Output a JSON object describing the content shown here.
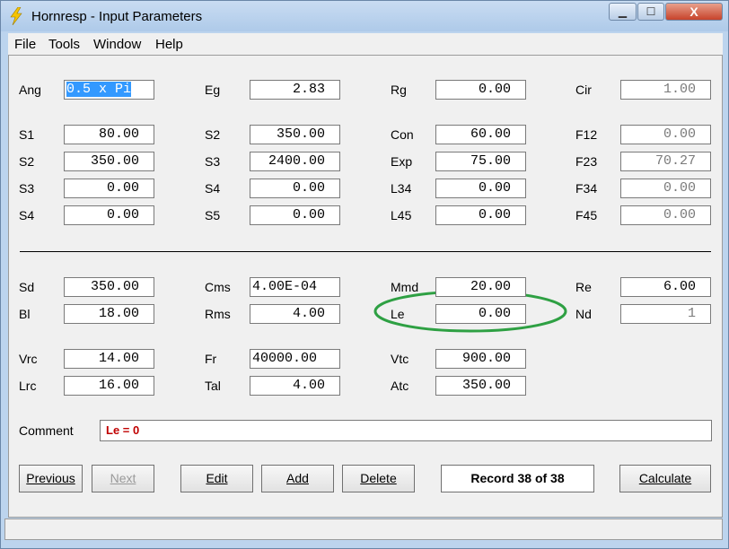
{
  "window": {
    "title": "Hornresp - Input Parameters",
    "controls": {
      "minimize": "▁",
      "maximize": "☐",
      "close": "X"
    }
  },
  "menu": [
    "File",
    "Tools",
    "Window",
    "Help"
  ],
  "rows": [
    {
      "top": 0,
      "fields": [
        {
          "label": "Ang",
          "value": "0.5 x Pi",
          "state": "selected"
        },
        {
          "label": "Eg",
          "value": "2.83"
        },
        {
          "label": "Rg",
          "value": "0.00"
        },
        {
          "label": "Cir",
          "value": "1.00",
          "state": "readonly"
        }
      ]
    },
    {
      "fields": [
        {
          "label": "S1",
          "value": "80.00"
        },
        {
          "label": "S2",
          "value": "350.00"
        },
        {
          "label": "Con",
          "value": "60.00"
        },
        {
          "label": "F12",
          "value": "0.00",
          "state": "readonly"
        }
      ]
    },
    {
      "fields": [
        {
          "label": "S2",
          "value": "350.00"
        },
        {
          "label": "S3",
          "value": "2400.00"
        },
        {
          "label": "Exp",
          "value": "75.00"
        },
        {
          "label": "F23",
          "value": "70.27",
          "state": "readonly"
        }
      ]
    },
    {
      "fields": [
        {
          "label": "S3",
          "value": "0.00"
        },
        {
          "label": "S4",
          "value": "0.00"
        },
        {
          "label": "L34",
          "value": "0.00"
        },
        {
          "label": "F34",
          "value": "0.00",
          "state": "readonly"
        }
      ]
    },
    {
      "fields": [
        {
          "label": "S4",
          "value": "0.00"
        },
        {
          "label": "S5",
          "value": "0.00"
        },
        {
          "label": "L45",
          "value": "0.00"
        },
        {
          "label": "F45",
          "value": "0.00",
          "state": "readonly"
        }
      ]
    },
    {
      "fields": [
        {
          "label": "Sd",
          "value": "350.00"
        },
        {
          "label": "Cms",
          "value": "4.00E-04",
          "state": "left"
        },
        {
          "label": "Mmd",
          "value": "20.00"
        },
        {
          "label": "Re",
          "value": "6.00"
        }
      ]
    },
    {
      "fields": [
        {
          "label": "Bl",
          "value": "18.00"
        },
        {
          "label": "Rms",
          "value": "4.00"
        },
        {
          "label": "Le",
          "value": "0.00"
        },
        {
          "label": "Nd",
          "value": "1",
          "state": "readonly"
        }
      ]
    },
    {
      "fields": [
        {
          "label": "Vrc",
          "value": "14.00"
        },
        {
          "label": "Fr",
          "value": "40000.00",
          "state": "left"
        },
        {
          "label": "Vtc",
          "value": "900.00"
        }
      ]
    },
    {
      "fields": [
        {
          "label": "Lrc",
          "value": "16.00"
        },
        {
          "label": "Tal",
          "value": "4.00"
        },
        {
          "label": "Atc",
          "value": "350.00"
        }
      ]
    }
  ],
  "comment": {
    "label": "Comment",
    "value": "Le = 0"
  },
  "buttons": {
    "previous": "Previous",
    "next": "Next",
    "edit": "Edit",
    "add": "Add",
    "delete": "Delete",
    "record": "Record 38 of 38",
    "calculate": "Calculate"
  },
  "annotation_color": "#2ea043"
}
